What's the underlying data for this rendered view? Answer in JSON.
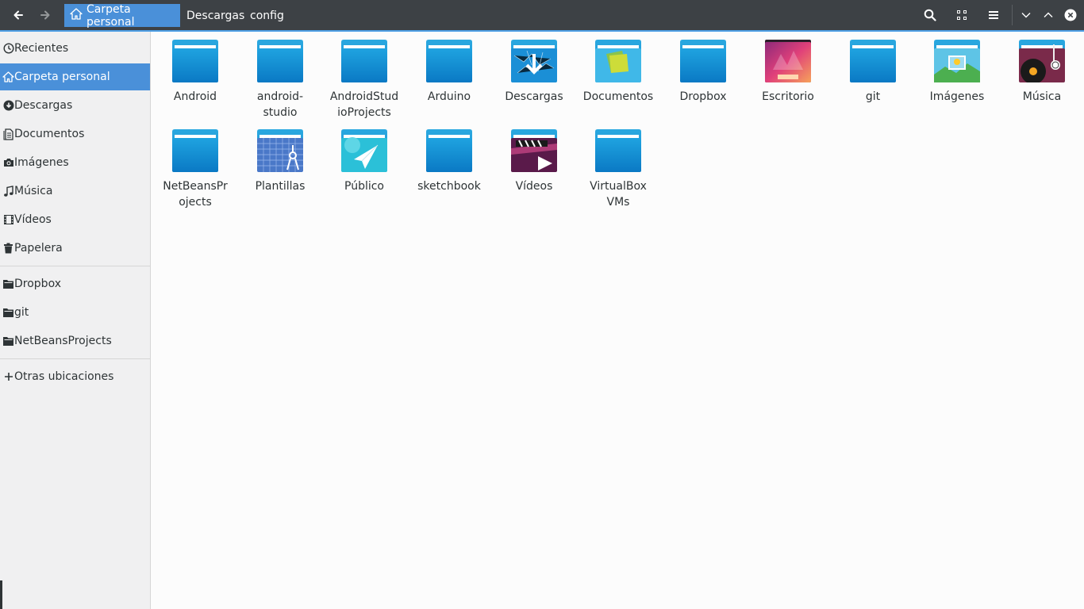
{
  "header": {
    "back_icon": "go-previous-icon",
    "forward_icon": "go-next-icon",
    "breadcrumbs": [
      {
        "label": "Carpeta personal",
        "icon": "home-icon",
        "active": true
      },
      {
        "label": "Descargas",
        "active": false
      },
      {
        "label": "config",
        "active": false
      }
    ],
    "actions": [
      "search-icon",
      "view-grid-icon",
      "menu-icon"
    ],
    "window_controls": [
      "minimize-icon",
      "maximize-icon",
      "close-icon"
    ],
    "accent": "#4a90d9"
  },
  "sidebar": {
    "places": [
      {
        "label": "Recientes",
        "icon": "clock-icon"
      },
      {
        "label": "Carpeta personal",
        "icon": "home-icon",
        "selected": true
      },
      {
        "label": "Descargas",
        "icon": "download-icon"
      },
      {
        "label": "Documentos",
        "icon": "document-icon"
      },
      {
        "label": "Imágenes",
        "icon": "camera-icon"
      },
      {
        "label": "Música",
        "icon": "music-icon"
      },
      {
        "label": "Vídeos",
        "icon": "film-icon"
      },
      {
        "label": "Papelera",
        "icon": "trash-icon"
      }
    ],
    "bookmarks": [
      {
        "label": "Dropbox",
        "icon": "folder-icon"
      },
      {
        "label": "git",
        "icon": "folder-icon"
      },
      {
        "label": "NetBeansProjects",
        "icon": "folder-icon"
      }
    ],
    "other_locations": {
      "label": "Otras ubicaciones",
      "icon": "plus-icon"
    }
  },
  "files": [
    {
      "name": "Android",
      "icon": "folder"
    },
    {
      "name": "android-studio",
      "icon": "folder"
    },
    {
      "name": "AndroidStudioProjects",
      "icon": "folder"
    },
    {
      "name": "Arduino",
      "icon": "folder"
    },
    {
      "name": "Descargas",
      "icon": "folder-download"
    },
    {
      "name": "Documentos",
      "icon": "folder-documents"
    },
    {
      "name": "Dropbox",
      "icon": "folder"
    },
    {
      "name": "Escritorio",
      "icon": "folder-desktop"
    },
    {
      "name": "git",
      "icon": "folder"
    },
    {
      "name": "Imágenes",
      "icon": "folder-pictures"
    },
    {
      "name": "Música",
      "icon": "folder-music"
    },
    {
      "name": "NetBeansProjects",
      "icon": "folder"
    },
    {
      "name": "Plantillas",
      "icon": "folder-templates"
    },
    {
      "name": "Público",
      "icon": "folder-public"
    },
    {
      "name": "sketchbook",
      "icon": "folder"
    },
    {
      "name": "Vídeos",
      "icon": "folder-videos"
    },
    {
      "name": "VirtualBox VMs",
      "icon": "folder"
    }
  ]
}
